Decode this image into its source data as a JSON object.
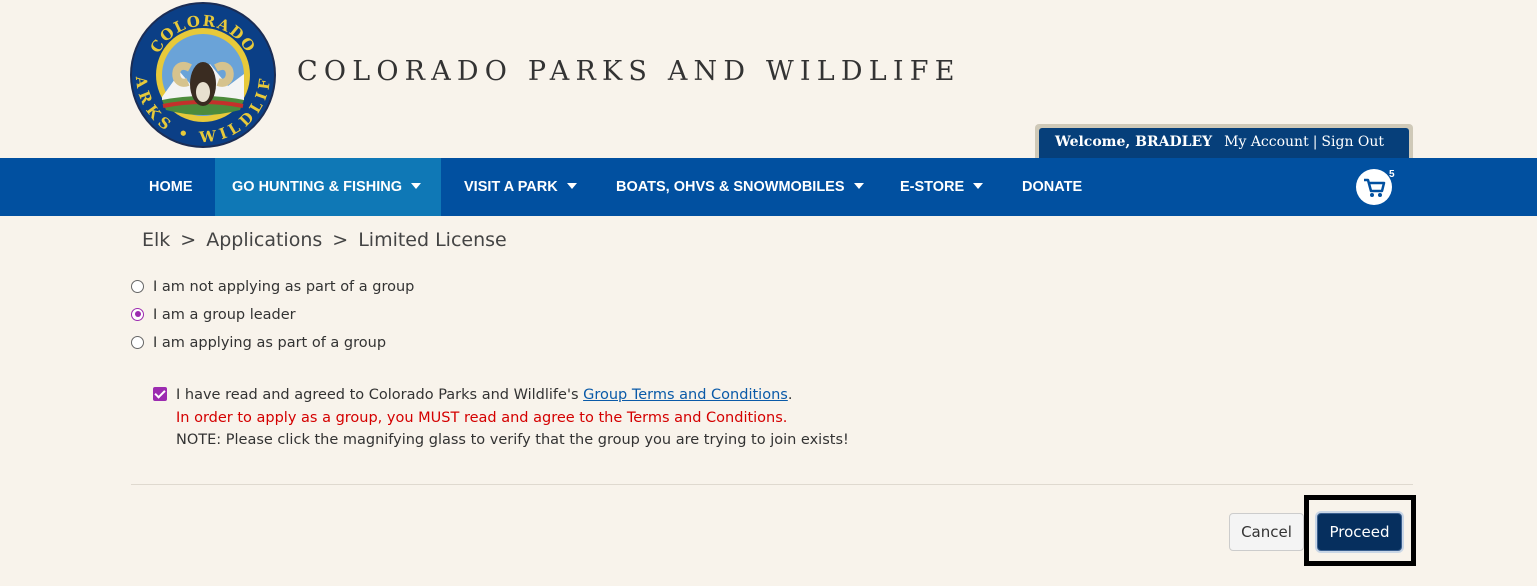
{
  "header": {
    "site_title": "COLORADO PARKS AND WILDLIFE",
    "logo": {
      "top_text": "COLORADO",
      "bottom_text": "PARKS • WILDLIFE"
    },
    "welcome": {
      "greeting": "Welcome, BRADLEY",
      "my_account": "My Account",
      "separator": "|",
      "sign_out": "Sign Out"
    }
  },
  "nav": {
    "items": [
      {
        "label": "HOME",
        "dropdown": false,
        "active": false
      },
      {
        "label": "GO HUNTING & FISHING",
        "dropdown": true,
        "active": true
      },
      {
        "label": "VISIT A PARK",
        "dropdown": true,
        "active": false
      },
      {
        "label": "BOATS, OHVS & SNOWMOBILES",
        "dropdown": true,
        "active": false
      },
      {
        "label": "E-STORE",
        "dropdown": true,
        "active": false
      },
      {
        "label": "DONATE",
        "dropdown": false,
        "active": false
      }
    ],
    "cart_count": "5",
    "cart_icon": "shopping-cart-icon"
  },
  "breadcrumb": {
    "items": [
      "Elk",
      "Applications",
      "Limited License"
    ],
    "separator": ">"
  },
  "group_options": [
    {
      "label": "I am not applying as part of a group",
      "checked": false
    },
    {
      "label": "I am a group leader",
      "checked": true
    },
    {
      "label": "I am applying as part of a group",
      "checked": false
    }
  ],
  "terms": {
    "checked": true,
    "text_before": "I have read and agreed to Colorado Parks and Wildlife's ",
    "link": "Group Terms and Conditions",
    "text_after": ".",
    "warning": "In order to apply as a group, you MUST read and agree to the Terms and Conditions.",
    "note": "NOTE: Please click the magnifying glass to verify that the group you are trying to join exists!"
  },
  "actions": {
    "cancel": "Cancel",
    "proceed": "Proceed"
  },
  "colors": {
    "nav_bg": "#0150a0",
    "nav_active": "#0f78b6",
    "welcome_bg": "#063f7a",
    "accent_purple": "#9c2bb0",
    "warning_red": "#d40000",
    "proceed_bg": "#062f5e",
    "page_bg": "#f8f3eb"
  }
}
